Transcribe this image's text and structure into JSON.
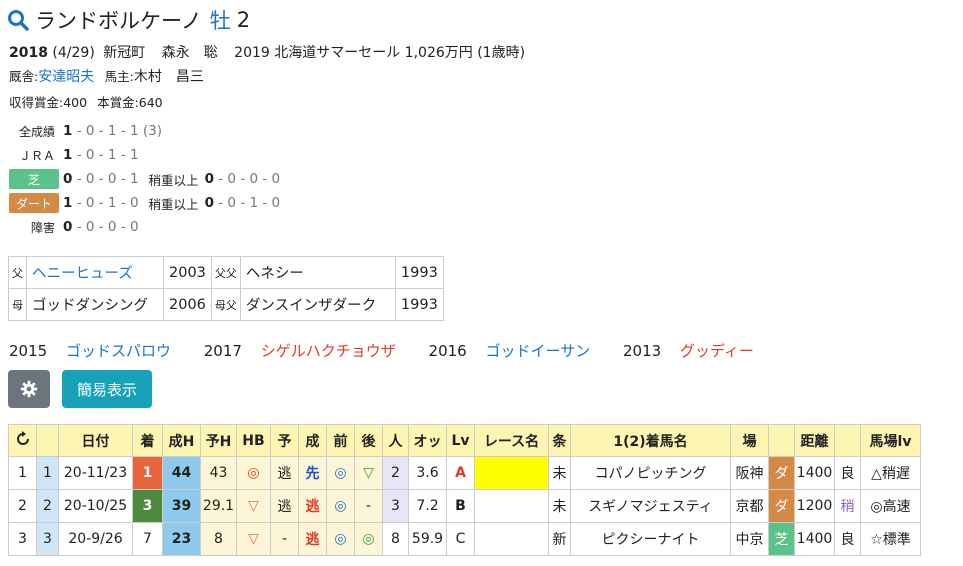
{
  "horse": {
    "name": "ランドボルケーノ",
    "sex": "牡",
    "age": "2"
  },
  "profile": {
    "year": "2018",
    "birthdate": "(4/29)",
    "birthplace": "新冠町",
    "breeder": "森永　聡",
    "sale": "2019 北海道サマーセール 1,026万円 (1歳時)",
    "trainer_label": "厩舎:",
    "trainer": "安達昭夫",
    "owner_label": "馬主:",
    "owner": "木村　昌三",
    "earned_label": "収得賞金:",
    "earned": "400",
    "prize_label": "本賞金:",
    "prize": "640"
  },
  "records": {
    "all": {
      "label": "全成績",
      "w": "1",
      "rest": "- 0 - 1 - 1 (3)"
    },
    "jra": {
      "label": "ＪＲＡ",
      "w": "1",
      "rest": "- 0 - 1 - 1"
    },
    "turf": {
      "label": "芝",
      "w": "0",
      "rest": "- 0 - 0 - 1",
      "sub_label": "稍重以上",
      "sub_w": "0",
      "sub_rest": "- 0 - 0 - 0"
    },
    "dirt": {
      "label": "ダート",
      "w": "1",
      "rest": "- 0 - 1 - 0",
      "sub_label": "稍重以上",
      "sub_w": "0",
      "sub_rest": "- 0 - 1 - 0"
    },
    "hurdle": {
      "label": "障害",
      "w": "0",
      "rest": "- 0 - 0 - 0"
    }
  },
  "pedigree": [
    {
      "k1": "父",
      "name": "ヘニーヒューズ",
      "year": "2003",
      "k2": "父父",
      "name2": "ヘネシー",
      "year2": "1993"
    },
    {
      "k1": "母",
      "name": "ゴッドダンシング",
      "year": "2006",
      "k2": "母父",
      "name2": "ダンスインザダーク",
      "year2": "1993"
    }
  ],
  "siblings": [
    {
      "year": "2015",
      "name": "ゴッドスパロウ",
      "color": "blue"
    },
    {
      "year": "2017",
      "name": "シゲルハクチョウザ",
      "color": "red"
    },
    {
      "year": "2016",
      "name": "ゴッドイーサン",
      "color": "blue"
    },
    {
      "year": "2013",
      "name": "グッディー",
      "color": "red"
    }
  ],
  "buttons": {
    "simple": "簡易表示"
  },
  "table": {
    "headers": [
      "日付",
      "着",
      "成H",
      "予H",
      "HB",
      "予",
      "成",
      "前",
      "後",
      "人",
      "オッ",
      "Lv",
      "レース名",
      "条",
      "1(2)着馬名",
      "場",
      "",
      "距離",
      "",
      "馬場lv"
    ],
    "rows": [
      {
        "n": "1",
        "m": "1",
        "date": "20-11/23",
        "rank": "1",
        "seiH": "44",
        "yoH": "43",
        "hb": "◎",
        "yo": "逃",
        "sei": "先",
        "mae": "◎",
        "ato": "▽",
        "pop": "2",
        "odds": "3.6",
        "lv": "A",
        "race": "",
        "cond": "未",
        "winner": "コパノピッチング",
        "place": "阪神",
        "surf": "ダ",
        "dist": "1400",
        "track": "良",
        "blv": "△稍遅"
      },
      {
        "n": "2",
        "m": "2",
        "date": "20-10/25",
        "rank": "3",
        "seiH": "39",
        "yoH": "29.1",
        "hb": "▽",
        "yo": "逃",
        "sei": "逃",
        "mae": "◎",
        "ato": "-",
        "pop": "3",
        "odds": "7.2",
        "lv": "B",
        "race": "",
        "cond": "未",
        "winner": "スギノマジェスティ",
        "place": "京都",
        "surf": "ダ",
        "dist": "1200",
        "track": "稍",
        "blv": "◎高速"
      },
      {
        "n": "3",
        "m": "3",
        "date": "20-9/26",
        "rank": "7",
        "seiH": "23",
        "yoH": "8",
        "hb": "▽",
        "yo": "-",
        "sei": "逃",
        "mae": "◎",
        "ato": "◎",
        "pop": "8",
        "odds": "59.9",
        "lv": "C",
        "race": "",
        "cond": "新",
        "winner": "ピクシーナイト",
        "place": "中京",
        "surf": "芝",
        "dist": "1400",
        "track": "良",
        "blv": "☆標準"
      }
    ]
  }
}
